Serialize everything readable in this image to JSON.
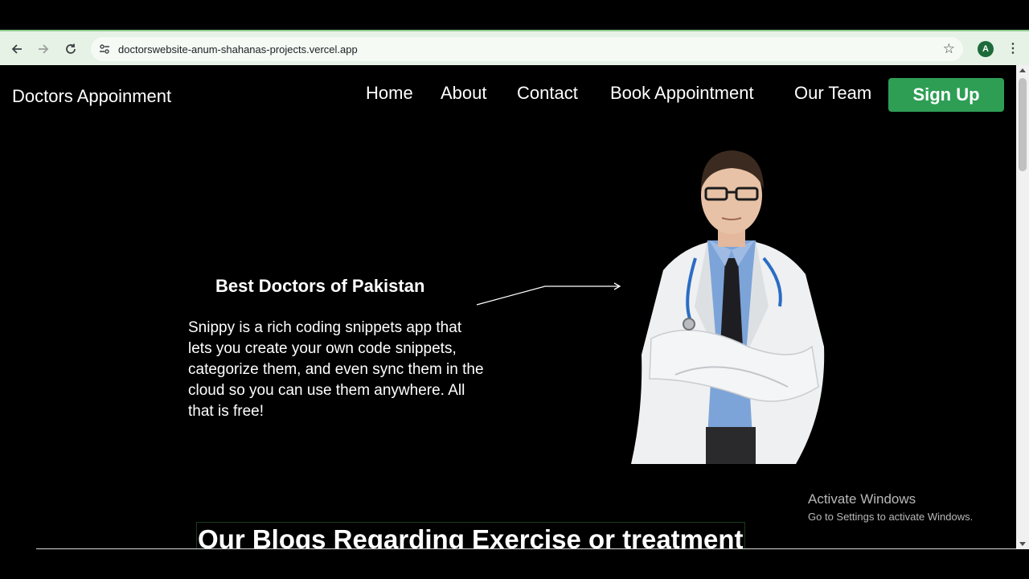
{
  "browser": {
    "url": "doctorswebsite-anum-shahanas-projects.vercel.app",
    "profile_initial": "A",
    "icons": {
      "back": "arrow-left-icon",
      "forward": "arrow-right-icon",
      "reload": "reload-icon",
      "site_info": "tune-icon",
      "bookmark": "star-icon",
      "menu": "kebab-menu-icon"
    }
  },
  "header": {
    "brand": "Doctors Appoinment",
    "nav": [
      {
        "label": "Home"
      },
      {
        "label": "About"
      },
      {
        "label": "Contact"
      },
      {
        "label": "Book Appointment"
      },
      {
        "label": "Our Team"
      }
    ],
    "signup_label": "Sign Up",
    "accent_color": "#2e9e55"
  },
  "hero": {
    "title": "Best Doctors of Pakistan",
    "text": "Snippy is a rich coding snippets app that lets you create your own code snippets, categorize them, and even sync them in the cloud so you can use them anywhere. All that is free!"
  },
  "blogs": {
    "title": "Our Blogs Regarding Exercise or treatment"
  },
  "os_watermark": {
    "line1": "Activate Windows",
    "line2": "Go to Settings to activate Windows."
  }
}
